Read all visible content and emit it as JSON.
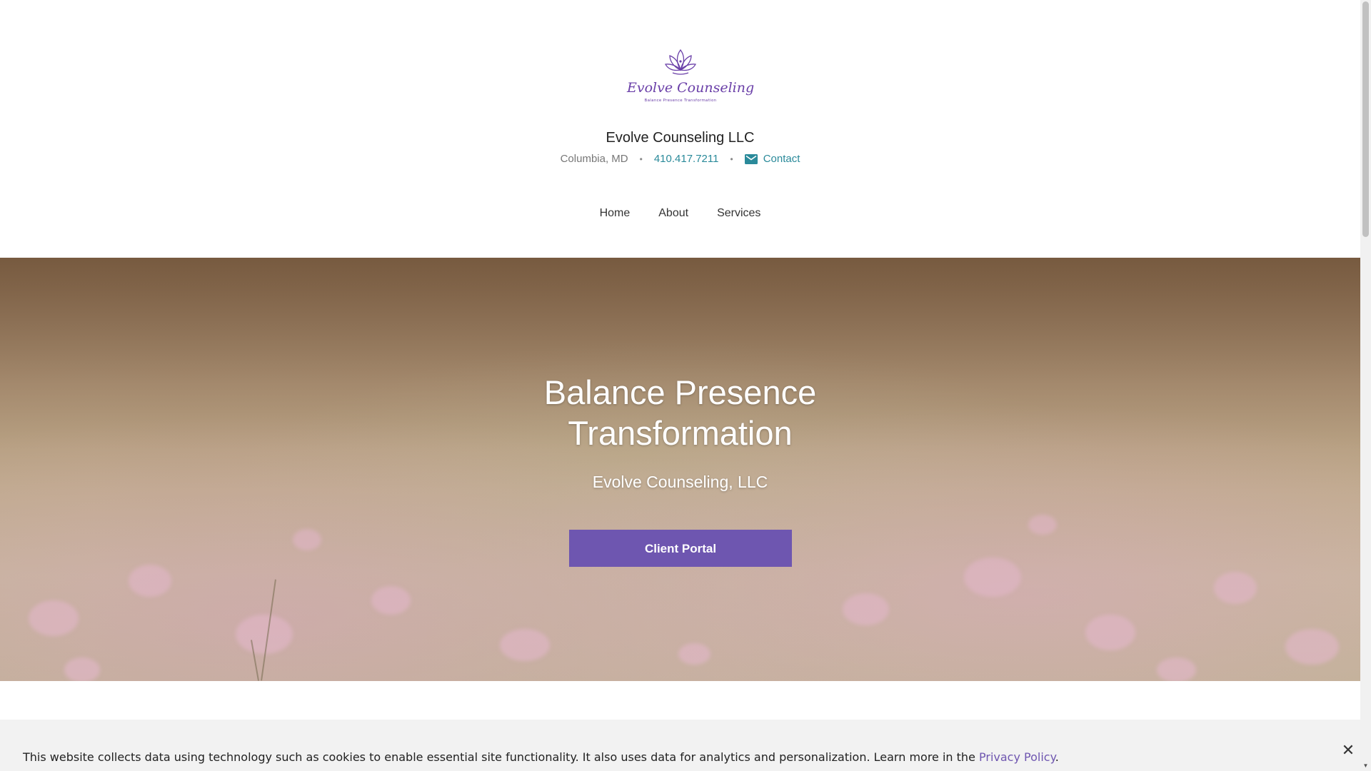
{
  "header": {
    "logo": {
      "wordmark": "Evolve Counseling",
      "tagline": "Balance Presence Transformation"
    },
    "business_name": "Evolve Counseling LLC",
    "location": "Columbia, MD",
    "separator": "•",
    "phone": "410.417.7211",
    "contact_label": "Contact",
    "contact_icon": "mail-icon"
  },
  "nav": {
    "items": [
      {
        "label": "Home"
      },
      {
        "label": "About"
      },
      {
        "label": "Services"
      }
    ]
  },
  "hero": {
    "title_line1": "Balance Presence",
    "title_line2": "Transformation",
    "subtitle": "Evolve Counseling, LLC",
    "cta_label": "Client Portal",
    "cta_color": "#6e56b0"
  },
  "cookie_banner": {
    "text": "This website collects data using technology such as cookies to enable essential site functionality. It also uses data for analytics and personalization. Learn more in the ",
    "link_label": "Privacy Policy",
    "suffix": ".",
    "close_icon": "close-icon"
  },
  "colors": {
    "accent_purple": "#6e56b0",
    "link_teal": "#2a8a9a",
    "logo_purple": "#6a3fa8"
  }
}
